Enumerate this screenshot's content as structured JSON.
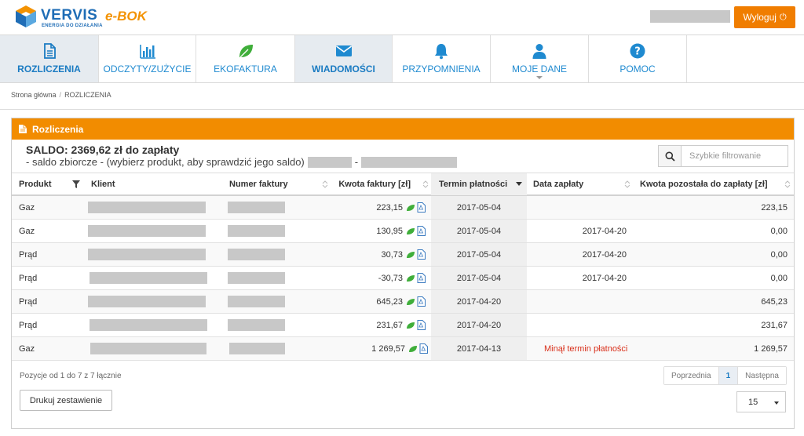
{
  "header": {
    "brand": "VERVIS",
    "brand_tagline": "ENERGIA DO DZIAŁANIA",
    "app_name": "e-BOK",
    "logout_label": "Wyloguj",
    "colors": {
      "brand_blue": "#1f6db6",
      "accent_orange": "#f28c00"
    }
  },
  "nav": {
    "tabs": [
      {
        "label": "ROZLICZENIA",
        "icon": "document-icon",
        "active": true
      },
      {
        "label": "ODCZYTY/ZUŻYCIE",
        "icon": "bar-chart-icon",
        "active": false
      },
      {
        "label": "EKOFAKTURA",
        "icon": "leaf-icon",
        "active": false
      },
      {
        "label": "WIADOMOŚCI",
        "icon": "envelope-icon",
        "active": false
      },
      {
        "label": "PRZYPOMNIENIA",
        "icon": "bell-icon",
        "active": false
      },
      {
        "label": "MOJE DANE",
        "icon": "user-icon",
        "active": false
      },
      {
        "label": "POMOC",
        "icon": "question-icon",
        "active": false
      }
    ]
  },
  "breadcrumb": {
    "home": "Strona główna",
    "separator": "/",
    "current": "ROZLICZENIA"
  },
  "panel": {
    "title": "Rozliczenia",
    "saldo": "SALDO: 2369,62 zł do zapłaty",
    "saldo_sub": "- saldo zbiorcze - (wybierz produkt, aby sprawdzić jego saldo)",
    "saldo_sub_dash": "-",
    "filter_placeholder": "Szybkie filtrowanie"
  },
  "table": {
    "columns": {
      "produkt": "Produkt",
      "klient": "Klient",
      "numer": "Numer faktury",
      "kwota": "Kwota faktury [zł]",
      "termin": "Termin płatności",
      "data": "Data zapłaty",
      "pozostala": "Kwota pozostała do zapłaty [zł]"
    },
    "rows": [
      {
        "produkt": "Gaz",
        "kwota": "223,15",
        "termin": "2017-05-04",
        "data": "",
        "pozostala": "223,15"
      },
      {
        "produkt": "Gaz",
        "kwota": "130,95",
        "termin": "2017-05-04",
        "data": "2017-04-20",
        "pozostala": "0,00"
      },
      {
        "produkt": "Prąd",
        "kwota": "30,73",
        "termin": "2017-05-04",
        "data": "2017-04-20",
        "pozostala": "0,00"
      },
      {
        "produkt": "Prąd",
        "kwota": "-30,73",
        "termin": "2017-05-04",
        "data": "2017-04-20",
        "pozostala": "0,00"
      },
      {
        "produkt": "Prąd",
        "kwota": "645,23",
        "termin": "2017-04-20",
        "data": "",
        "pozostala": "645,23"
      },
      {
        "produkt": "Prąd",
        "kwota": "231,67",
        "termin": "2017-04-20",
        "data": "",
        "pozostala": "231,67"
      },
      {
        "produkt": "Gaz",
        "kwota": "1 269,57",
        "termin": "2017-04-13",
        "data": "Minął termin płatności",
        "data_overdue": true,
        "pozostala": "1 269,57"
      }
    ]
  },
  "footer": {
    "info": "Pozycje od 1 do 7 z 7 łącznie",
    "prev": "Poprzednia",
    "page": "1",
    "next": "Następna",
    "print": "Drukuj zestawienie",
    "page_size": "15"
  }
}
